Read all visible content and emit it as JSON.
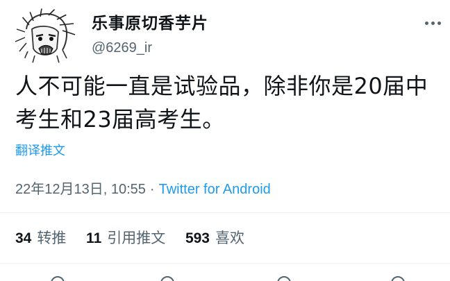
{
  "tweet": {
    "display_name": "乐事原切香芋片",
    "handle": "@6269_ir",
    "text": "人不可能一直是试验品，除非你是20届中考生和23届高考生。",
    "translate_label": "翻译推文",
    "timestamp": "22年12月13日, 10:55",
    "separator": "·",
    "source": "Twitter for Android",
    "stats": [
      {
        "count": "34",
        "label": "转推"
      },
      {
        "count": "11",
        "label": "引用推文"
      },
      {
        "count": "593",
        "label": "喜欢"
      }
    ]
  },
  "icons": {
    "more": "more-options-icon",
    "avatar": "avatar-sketch"
  },
  "colors": {
    "link": "#1d9bf0",
    "text_primary": "#0f1419",
    "text_secondary": "#536471",
    "divider": "#eff3f4"
  }
}
